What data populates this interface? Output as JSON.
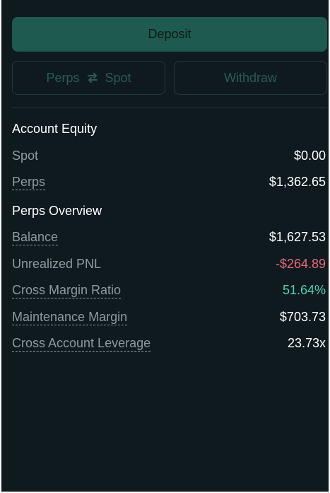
{
  "actions": {
    "deposit_label": "Deposit",
    "perps_label": "Perps",
    "spot_label": "Spot",
    "withdraw_label": "Withdraw"
  },
  "account_equity": {
    "heading": "Account Equity",
    "rows": [
      {
        "label": "Spot",
        "value": "$0.00"
      },
      {
        "label": "Perps",
        "value": "$1,362.65"
      }
    ]
  },
  "perps_overview": {
    "heading": "Perps Overview",
    "rows": [
      {
        "label": "Balance",
        "value": "$1,627.53"
      },
      {
        "label": "Unrealized PNL",
        "value": "-$264.89"
      },
      {
        "label": "Cross Margin Ratio",
        "value": "51.64%"
      },
      {
        "label": "Maintenance Margin",
        "value": "$703.73"
      },
      {
        "label": "Cross Account Leverage",
        "value": "23.73x"
      }
    ]
  },
  "colors": {
    "panel_bg": "#0f1a1f",
    "deposit_bg": "#1e5a4f",
    "negative": "#e8677a",
    "positive": "#4fd1b4"
  },
  "icons": {
    "swap": "swap-arrows-icon"
  }
}
